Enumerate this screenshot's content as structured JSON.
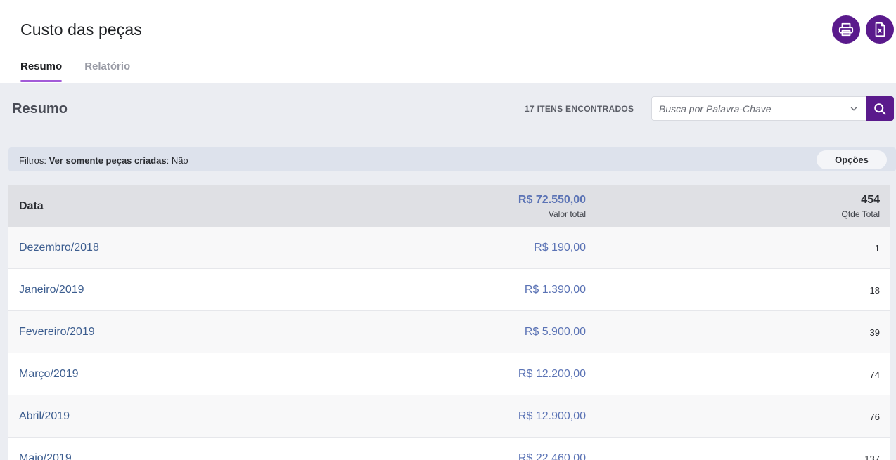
{
  "header": {
    "title": "Custo das peças",
    "print_icon": "printer-icon",
    "excel_icon": "excel-file-icon"
  },
  "tabs": [
    {
      "label": "Resumo",
      "active": true
    },
    {
      "label": "Relatório",
      "active": false
    }
  ],
  "main": {
    "title": "Resumo",
    "found": "17 ITENS ENCONTRADOS",
    "search": {
      "placeholder": "Busca por Palavra-Chave",
      "value": ""
    }
  },
  "filters": {
    "prefix": "Filtros:",
    "name": "Ver somente peças criadas",
    "separator": ":",
    "value": "Não",
    "options_label": "Opções"
  },
  "table": {
    "col_date": "Data",
    "total_value": "R$ 72.550,00",
    "total_value_label": "Valor total",
    "total_qty": "454",
    "total_qty_label": "Qtde Total",
    "rows": [
      {
        "date": "Dezembro/2018",
        "value": "R$ 190,00",
        "qty": "1"
      },
      {
        "date": "Janeiro/2019",
        "value": "R$ 1.390,00",
        "qty": "18"
      },
      {
        "date": "Fevereiro/2019",
        "value": "R$ 5.900,00",
        "qty": "39"
      },
      {
        "date": "Março/2019",
        "value": "R$ 12.200,00",
        "qty": "74"
      },
      {
        "date": "Abril/2019",
        "value": "R$ 12.900,00",
        "qty": "76"
      },
      {
        "date": "Maio/2019",
        "value": "R$ 22.460,00",
        "qty": "137"
      }
    ]
  },
  "colors": {
    "accent": "#5a1a8c",
    "tab_underline": "#a25bd8",
    "value_blue": "#5b73b5",
    "link_blue": "#3c5d8f"
  }
}
